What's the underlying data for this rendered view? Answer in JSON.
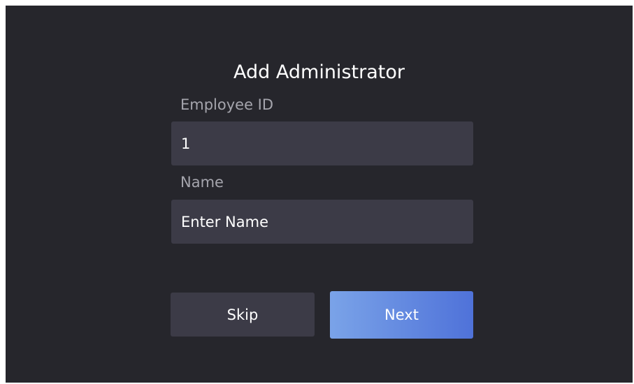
{
  "dialog": {
    "title": "Add Administrator"
  },
  "fields": {
    "employee_id": {
      "label": "Employee ID",
      "value": "1"
    },
    "name": {
      "label": "Name",
      "placeholder": "Enter Name"
    }
  },
  "buttons": {
    "skip_label": "Skip",
    "next_label": "Next"
  },
  "colors": {
    "background": "#26262c",
    "field_background": "#3c3b47",
    "label_text": "#a5a5ad",
    "next_gradient_start": "#7aa3e8",
    "next_gradient_end": "#4f72d9"
  }
}
